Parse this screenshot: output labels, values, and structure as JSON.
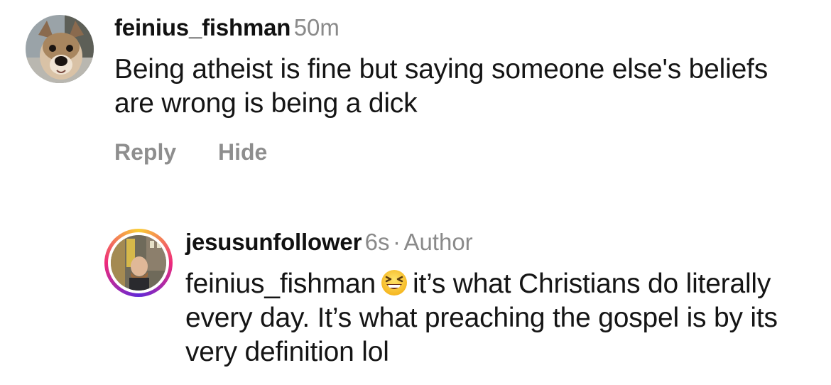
{
  "comments": [
    {
      "username": "feinius_fishman",
      "time": "50m",
      "author_badge": "",
      "text": "Being atheist is fine but saying someone else's beliefs are wrong is being a dick",
      "actions": {
        "reply": "Reply",
        "hide": "Hide"
      }
    },
    {
      "username": "jesusunfollower",
      "time": "6s",
      "separator": "·",
      "author_badge": "Author",
      "mention": "feinius_fishman",
      "emoji": "grinning-squinting-face-emoji",
      "text_after_emoji": "it’s what Christians do literally every day. It’s what preaching the gospel is by its very definition lol"
    }
  ],
  "colors": {
    "text": "#151515",
    "muted": "#8a8a8a",
    "story_ring_start": "#f9ce34",
    "story_ring_mid": "#ee2a7b",
    "story_ring_end": "#6228d7"
  }
}
